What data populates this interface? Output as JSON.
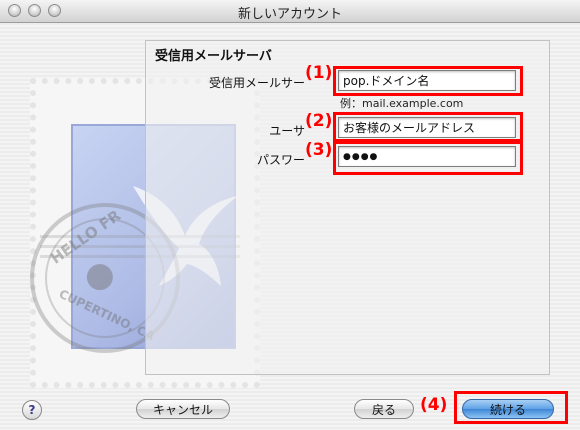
{
  "window": {
    "title": "新しいアカウント"
  },
  "form": {
    "section_title": "受信用メールサーバ",
    "server_label": "受信用メールサー",
    "server_value": "pop.ドメイン名",
    "server_hint": "例：mail.example.com",
    "user_label": "ユーサ",
    "user_value": "お客様のメールアドレス",
    "password_label": "パスワー",
    "password_value": "●●●●"
  },
  "annotations": {
    "n1": "(1)",
    "n2": "(2)",
    "n3": "(3)",
    "n4": "(4)"
  },
  "illustration": {
    "postmark_top": "HELLO FR",
    "postmark_bottom": "CUPERTINO, CA"
  },
  "buttons": {
    "help": "?",
    "cancel": "キャンセル",
    "back": "戻る",
    "continue": "続ける"
  },
  "colors": {
    "annotation_red": "#ff0000",
    "primary_button": "#5ea2e6"
  }
}
